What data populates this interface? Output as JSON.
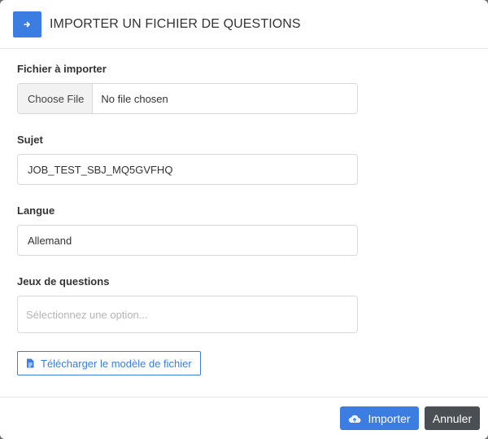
{
  "dialog": {
    "title": "IMPORTER UN FICHIER DE QUESTIONS",
    "header_icon": "file-import-icon",
    "accent_color": "#3b7de0"
  },
  "form": {
    "file": {
      "label": "Fichier à importer",
      "button_label": "Choose File",
      "status": "No file chosen"
    },
    "subject": {
      "label": "Sujet",
      "value": "JOB_TEST_SBJ_MQ5GVFHQ"
    },
    "language": {
      "label": "Langue",
      "value": "Allemand"
    },
    "question_sets": {
      "label": "Jeux de questions",
      "placeholder": "Sélectionnez une option..."
    },
    "download_template": {
      "label": "Télécharger le modèle de fichier",
      "icon": "document-icon"
    }
  },
  "footer": {
    "import_label": "Importer",
    "import_icon": "cloud-upload-icon",
    "cancel_label": "Annuler",
    "cancel_color": "#4a4f54"
  }
}
